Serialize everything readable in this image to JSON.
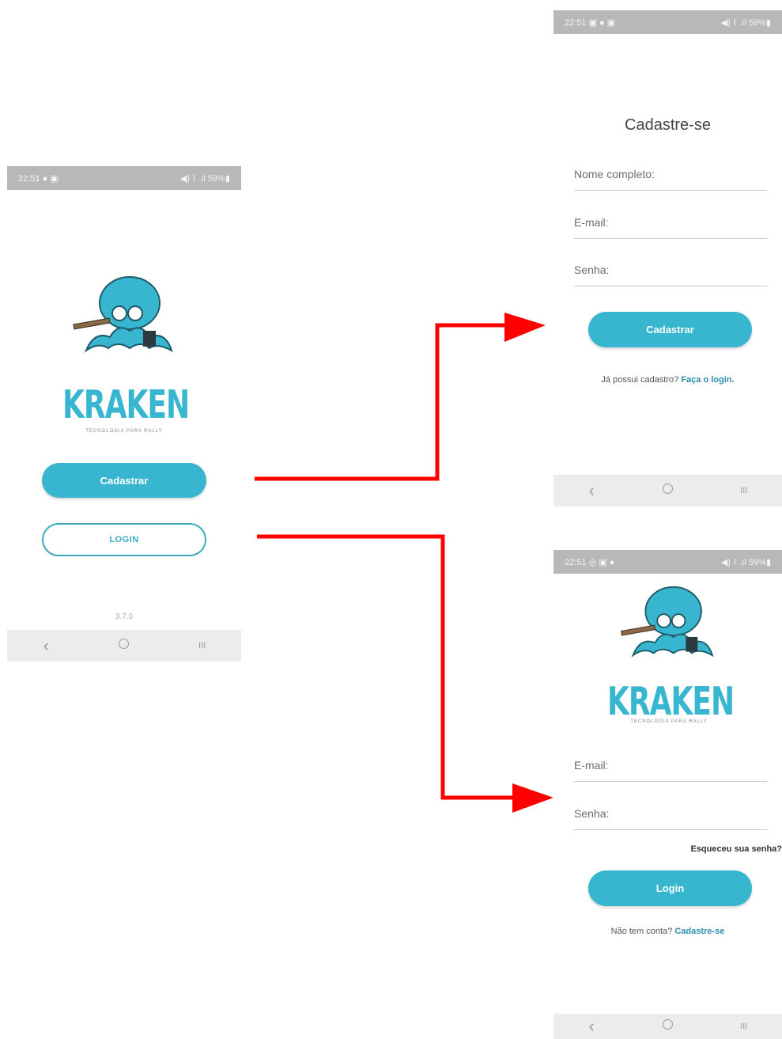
{
  "status": {
    "time": "22:51",
    "left_icons": "● ▣",
    "right_icons": "◀) ⌇ .ıl 59%▮",
    "right_icons_2": "◀) ⌇ .ıl 59%▮",
    "right_icons_3": "◀) ⌇ .ıl 59%▮",
    "left_icons_2": "▣ ● ▣",
    "left_icons_3": "◎ ▣ ● ·"
  },
  "brand": {
    "name": "KRAKEN",
    "tagline": "TECNOLOGIA PARA RALLY"
  },
  "home": {
    "register_label": "Cadastrar",
    "login_label": "LOGIN",
    "version": "3.7.0"
  },
  "register": {
    "title": "Cadastre-se",
    "name_placeholder": "Nome completo:",
    "email_placeholder": "E-mail:",
    "password_placeholder": "Senha:",
    "submit_label": "Cadastrar",
    "has_account_text": "Já possui cadastro?",
    "login_link": "Faça o login."
  },
  "login": {
    "email_placeholder": "E-mail:",
    "password_placeholder": "Senha:",
    "forgot_label": "Esqueceu sua senha?",
    "submit_label": "Login",
    "no_account_text": "Não tem conta?",
    "register_link": "Cadastre-se"
  },
  "nav": {
    "back": "‹",
    "recents": "III"
  },
  "colors": {
    "accent": "#38b6d0",
    "arrow": "#ff0000",
    "statusbar": "#b8b8b8"
  }
}
